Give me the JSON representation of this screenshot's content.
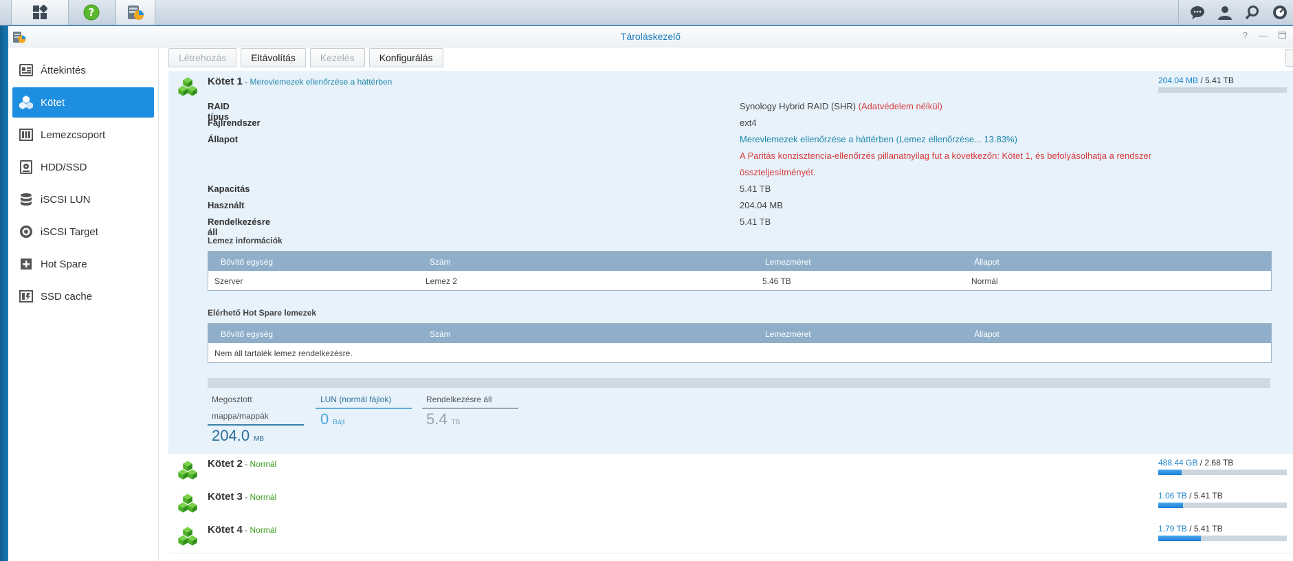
{
  "window": {
    "title": "Tároláskezelő"
  },
  "colors": {
    "accent": "#1e8ee0",
    "error": "#d83b3b",
    "normal": "#3b9c1b",
    "link": "#1f86a8"
  },
  "sidebar": {
    "items": [
      {
        "label": "Áttekintés",
        "icon": "overview-icon",
        "active": false
      },
      {
        "label": "Kötet",
        "icon": "volume-icon",
        "active": true
      },
      {
        "label": "Lemezcsoport",
        "icon": "disk-group-icon",
        "active": false
      },
      {
        "label": "HDD/SSD",
        "icon": "hdd-icon",
        "active": false
      },
      {
        "label": "iSCSI LUN",
        "icon": "database-icon",
        "active": false
      },
      {
        "label": "iSCSI Target",
        "icon": "target-icon",
        "active": false
      },
      {
        "label": "Hot Spare",
        "icon": "plus-icon",
        "active": false
      },
      {
        "label": "SSD cache",
        "icon": "cache-icon",
        "active": false
      }
    ]
  },
  "toolbar": {
    "create": "Létrehozás",
    "remove": "Eltávolítás",
    "manage": "Kezelés",
    "configure": "Konfigurálás"
  },
  "volume1": {
    "name": "Kötet 1",
    "sep": " - ",
    "status": "Merevlemezek ellenőrzése a háttérben",
    "used": "204.04 MB",
    "slash": " / ",
    "total": "5.41 TB",
    "usage_fraction": 4e-05,
    "props": {
      "raid_label": "RAID típus",
      "raid_value": "Synology Hybrid RAID (SHR)",
      "raid_note": "(Adatvédelem nélkül)",
      "fs_label": "Fájlrendszer",
      "fs_value": "ext4",
      "state_label": "Állapot",
      "state_value": "Merevlemezek ellenőrzése a háttérben (Lemez ellenőrzése... 13.83%)",
      "warning_line1": "A Paritás konzisztencia-ellenőrzés pillanatnyilag fut a következőn: Kötet 1, és befolyásolhatja a rendszer",
      "warning_line2": "összteljesítményét.",
      "capacity_label": "Kapacitás",
      "capacity_value": "5.41 TB",
      "used_label": "Használt",
      "used_value": "204.04 MB",
      "avail_label": "Rendelkezésre áll",
      "avail_value": "5.41 TB"
    },
    "disk_info": {
      "title": "Lemez információk",
      "headers": [
        "Bővítő egység",
        "Szám",
        "Lemezméret",
        "Állapot"
      ],
      "row": [
        "Szerver",
        "Lemez 2",
        "5.46 TB",
        "Normál"
      ]
    },
    "hot_spare": {
      "title": "Elérhető Hot Spare lemezek",
      "headers": [
        "Bővítő egység",
        "Szám",
        "Lemezméret",
        "Állapot"
      ],
      "empty": "Nem áll tartalék lemez rendelkezésre."
    },
    "stats": {
      "shared_label1": "Megosztott",
      "shared_label2": "mappa/mappák",
      "shared_value": "204.0",
      "shared_unit": "MB",
      "lun_label": "LUN (normál fájlok)",
      "lun_value": "0",
      "lun_unit": "Bájt",
      "free_label": "Rendelkezésre áll",
      "free_value": "5.4",
      "free_unit": "TB"
    }
  },
  "volumes": [
    {
      "name": "Kötet 2",
      "sep": " - ",
      "status": "Normál",
      "used": "488.44 GB",
      "slash": " / ",
      "total": "2.68 TB",
      "usage_fraction": 0.18
    },
    {
      "name": "Kötet 3",
      "sep": " - ",
      "status": "Normál",
      "used": "1.06 TB",
      "slash": " / ",
      "total": "5.41 TB",
      "usage_fraction": 0.19
    },
    {
      "name": "Kötet 4",
      "sep": " - ",
      "status": "Normál",
      "used": "1.79 TB",
      "slash": " / ",
      "total": "5.41 TB",
      "usage_fraction": 0.33
    }
  ]
}
